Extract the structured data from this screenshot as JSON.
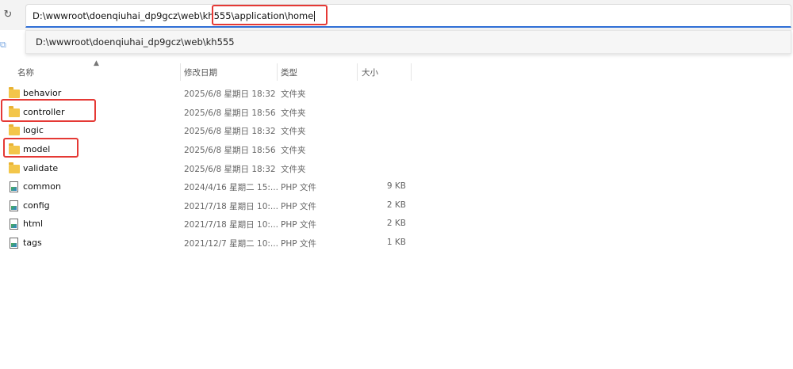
{
  "address": {
    "path": "D:\\wwwroot\\doenqiuhai_dp9gcz\\web\\kh555\\application\\home",
    "suggestion": "D:\\wwwroot\\doenqiuhai_dp9gcz\\web\\kh555"
  },
  "columns": {
    "name": "名称",
    "modified": "修改日期",
    "type": "类型",
    "size": "大小"
  },
  "files": [
    {
      "name": "behavior",
      "modified": "2025/6/8 星期日 18:32",
      "type": "文件夹",
      "size": "",
      "icon": "folder-icon"
    },
    {
      "name": "controller",
      "modified": "2025/6/8 星期日 18:56",
      "type": "文件夹",
      "size": "",
      "icon": "folder-icon"
    },
    {
      "name": "logic",
      "modified": "2025/6/8 星期日 18:32",
      "type": "文件夹",
      "size": "",
      "icon": "folder-icon"
    },
    {
      "name": "model",
      "modified": "2025/6/8 星期日 18:56",
      "type": "文件夹",
      "size": "",
      "icon": "folder-icon"
    },
    {
      "name": "validate",
      "modified": "2025/6/8 星期日 18:32",
      "type": "文件夹",
      "size": "",
      "icon": "folder-icon"
    },
    {
      "name": "common",
      "modified": "2024/4/16 星期二 15:...",
      "type": "PHP 文件",
      "size": "9 KB",
      "icon": "php-file-icon"
    },
    {
      "name": "config",
      "modified": "2021/7/18 星期日 10:...",
      "type": "PHP 文件",
      "size": "2 KB",
      "icon": "php-file-icon"
    },
    {
      "name": "html",
      "modified": "2021/7/18 星期日 10:...",
      "type": "PHP 文件",
      "size": "2 KB",
      "icon": "php-file-icon"
    },
    {
      "name": "tags",
      "modified": "2021/12/7 星期二 10:...",
      "type": "PHP 文件",
      "size": "1 KB",
      "icon": "php-file-icon"
    }
  ],
  "colors": {
    "highlight": "#e53935",
    "folder": "#f3c64a",
    "accent": "#2f6fd6"
  }
}
